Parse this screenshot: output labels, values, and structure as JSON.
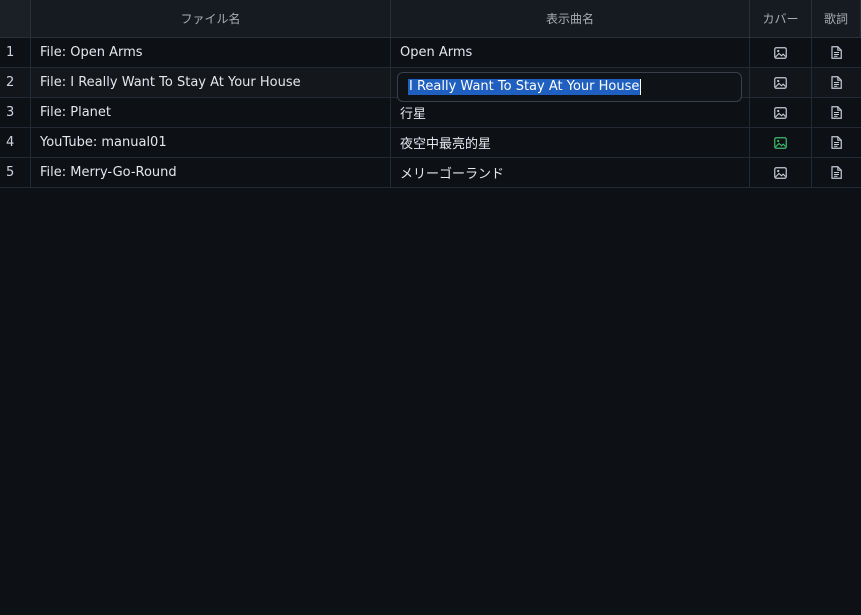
{
  "headers": {
    "index": "",
    "file_name": "ファイル名",
    "display_name": "表示曲名",
    "cover": "カバー",
    "lyrics": "歌詞"
  },
  "rows": [
    {
      "index": "1",
      "file_name": "File: Open Arms",
      "display_name": "Open Arms",
      "cover_icon": "image-icon",
      "cover_active": false,
      "lyrics_icon": "document-icon"
    },
    {
      "index": "2",
      "file_name": "File: I Really Want To Stay At Your House",
      "display_name": "",
      "cover_icon": "image-icon",
      "cover_active": false,
      "lyrics_icon": "document-icon"
    },
    {
      "index": "3",
      "file_name": "File: Planet",
      "display_name": "行星",
      "cover_icon": "image-icon",
      "cover_active": false,
      "lyrics_icon": "document-icon"
    },
    {
      "index": "4",
      "file_name": "YouTube: manual01",
      "display_name": "夜空中最亮的星",
      "cover_icon": "image-icon",
      "cover_active": true,
      "lyrics_icon": "document-icon"
    },
    {
      "index": "5",
      "file_name": "File: Merry-Go-Round",
      "display_name": "メリーゴーランド",
      "cover_icon": "image-icon",
      "cover_active": false,
      "lyrics_icon": "document-icon"
    }
  ],
  "editor": {
    "value": "I Really Want To Stay At Your House"
  },
  "colors": {
    "icon_default": "#c7ccd3",
    "icon_active": "#3fbf6f",
    "selection": "#1f5fbf"
  }
}
